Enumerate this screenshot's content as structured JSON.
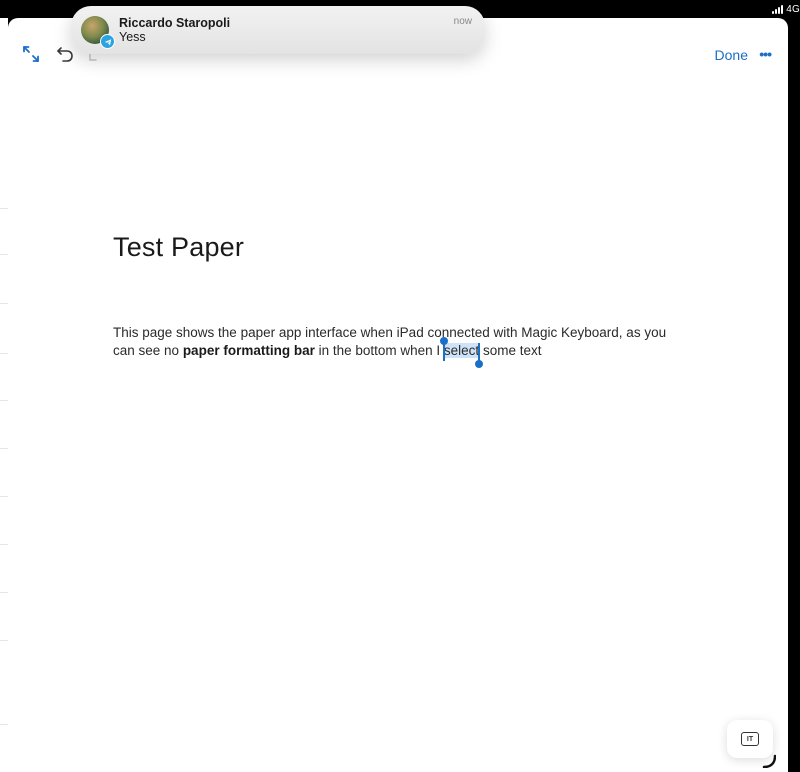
{
  "status_bar": {
    "network": "4G"
  },
  "toolbar": {
    "done_label": "Done",
    "more_label": "•••"
  },
  "document": {
    "title": "Test Paper",
    "body": {
      "segment_1": "This page shows the paper app interface when iPad connected with Magic Keyboard, as you can see no ",
      "bold": "paper formatting bar",
      "segment_2": " in the bottom when I ",
      "selected": "select",
      "segment_3": " some text"
    }
  },
  "notification": {
    "sender": "Riccardo Staropoli",
    "message": "Yess",
    "time": "now",
    "app_icon": "telegram-icon"
  },
  "keyboard_button": {
    "icon": "keyboard-icon",
    "label": "IT"
  },
  "colors": {
    "accent": "#1a6fc7",
    "selection": "#cfe3f8",
    "telegram": "#2aa3df"
  }
}
